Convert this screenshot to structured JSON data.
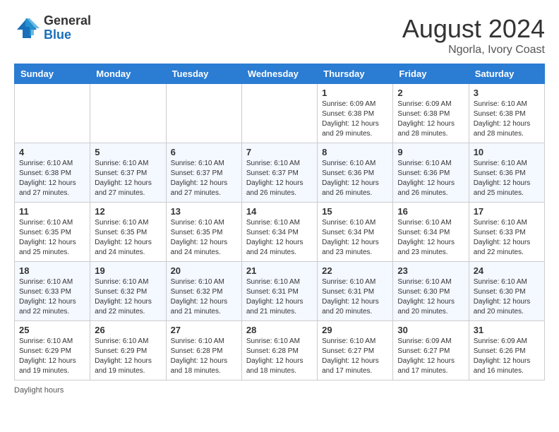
{
  "logo": {
    "general": "General",
    "blue": "Blue"
  },
  "header": {
    "month": "August 2024",
    "location": "Ngorla, Ivory Coast"
  },
  "days_of_week": [
    "Sunday",
    "Monday",
    "Tuesday",
    "Wednesday",
    "Thursday",
    "Friday",
    "Saturday"
  ],
  "weeks": [
    [
      {
        "day": "",
        "info": ""
      },
      {
        "day": "",
        "info": ""
      },
      {
        "day": "",
        "info": ""
      },
      {
        "day": "",
        "info": ""
      },
      {
        "day": "1",
        "info": "Sunrise: 6:09 AM\nSunset: 6:38 PM\nDaylight: 12 hours and 29 minutes."
      },
      {
        "day": "2",
        "info": "Sunrise: 6:09 AM\nSunset: 6:38 PM\nDaylight: 12 hours and 28 minutes."
      },
      {
        "day": "3",
        "info": "Sunrise: 6:10 AM\nSunset: 6:38 PM\nDaylight: 12 hours and 28 minutes."
      }
    ],
    [
      {
        "day": "4",
        "info": "Sunrise: 6:10 AM\nSunset: 6:38 PM\nDaylight: 12 hours and 27 minutes."
      },
      {
        "day": "5",
        "info": "Sunrise: 6:10 AM\nSunset: 6:37 PM\nDaylight: 12 hours and 27 minutes."
      },
      {
        "day": "6",
        "info": "Sunrise: 6:10 AM\nSunset: 6:37 PM\nDaylight: 12 hours and 27 minutes."
      },
      {
        "day": "7",
        "info": "Sunrise: 6:10 AM\nSunset: 6:37 PM\nDaylight: 12 hours and 26 minutes."
      },
      {
        "day": "8",
        "info": "Sunrise: 6:10 AM\nSunset: 6:36 PM\nDaylight: 12 hours and 26 minutes."
      },
      {
        "day": "9",
        "info": "Sunrise: 6:10 AM\nSunset: 6:36 PM\nDaylight: 12 hours and 26 minutes."
      },
      {
        "day": "10",
        "info": "Sunrise: 6:10 AM\nSunset: 6:36 PM\nDaylight: 12 hours and 25 minutes."
      }
    ],
    [
      {
        "day": "11",
        "info": "Sunrise: 6:10 AM\nSunset: 6:35 PM\nDaylight: 12 hours and 25 minutes."
      },
      {
        "day": "12",
        "info": "Sunrise: 6:10 AM\nSunset: 6:35 PM\nDaylight: 12 hours and 24 minutes."
      },
      {
        "day": "13",
        "info": "Sunrise: 6:10 AM\nSunset: 6:35 PM\nDaylight: 12 hours and 24 minutes."
      },
      {
        "day": "14",
        "info": "Sunrise: 6:10 AM\nSunset: 6:34 PM\nDaylight: 12 hours and 24 minutes."
      },
      {
        "day": "15",
        "info": "Sunrise: 6:10 AM\nSunset: 6:34 PM\nDaylight: 12 hours and 23 minutes."
      },
      {
        "day": "16",
        "info": "Sunrise: 6:10 AM\nSunset: 6:34 PM\nDaylight: 12 hours and 23 minutes."
      },
      {
        "day": "17",
        "info": "Sunrise: 6:10 AM\nSunset: 6:33 PM\nDaylight: 12 hours and 22 minutes."
      }
    ],
    [
      {
        "day": "18",
        "info": "Sunrise: 6:10 AM\nSunset: 6:33 PM\nDaylight: 12 hours and 22 minutes."
      },
      {
        "day": "19",
        "info": "Sunrise: 6:10 AM\nSunset: 6:32 PM\nDaylight: 12 hours and 22 minutes."
      },
      {
        "day": "20",
        "info": "Sunrise: 6:10 AM\nSunset: 6:32 PM\nDaylight: 12 hours and 21 minutes."
      },
      {
        "day": "21",
        "info": "Sunrise: 6:10 AM\nSunset: 6:31 PM\nDaylight: 12 hours and 21 minutes."
      },
      {
        "day": "22",
        "info": "Sunrise: 6:10 AM\nSunset: 6:31 PM\nDaylight: 12 hours and 20 minutes."
      },
      {
        "day": "23",
        "info": "Sunrise: 6:10 AM\nSunset: 6:30 PM\nDaylight: 12 hours and 20 minutes."
      },
      {
        "day": "24",
        "info": "Sunrise: 6:10 AM\nSunset: 6:30 PM\nDaylight: 12 hours and 20 minutes."
      }
    ],
    [
      {
        "day": "25",
        "info": "Sunrise: 6:10 AM\nSunset: 6:29 PM\nDaylight: 12 hours and 19 minutes."
      },
      {
        "day": "26",
        "info": "Sunrise: 6:10 AM\nSunset: 6:29 PM\nDaylight: 12 hours and 19 minutes."
      },
      {
        "day": "27",
        "info": "Sunrise: 6:10 AM\nSunset: 6:28 PM\nDaylight: 12 hours and 18 minutes."
      },
      {
        "day": "28",
        "info": "Sunrise: 6:10 AM\nSunset: 6:28 PM\nDaylight: 12 hours and 18 minutes."
      },
      {
        "day": "29",
        "info": "Sunrise: 6:10 AM\nSunset: 6:27 PM\nDaylight: 12 hours and 17 minutes."
      },
      {
        "day": "30",
        "info": "Sunrise: 6:09 AM\nSunset: 6:27 PM\nDaylight: 12 hours and 17 minutes."
      },
      {
        "day": "31",
        "info": "Sunrise: 6:09 AM\nSunset: 6:26 PM\nDaylight: 12 hours and 16 minutes."
      }
    ]
  ],
  "footer": {
    "label": "Daylight hours"
  }
}
